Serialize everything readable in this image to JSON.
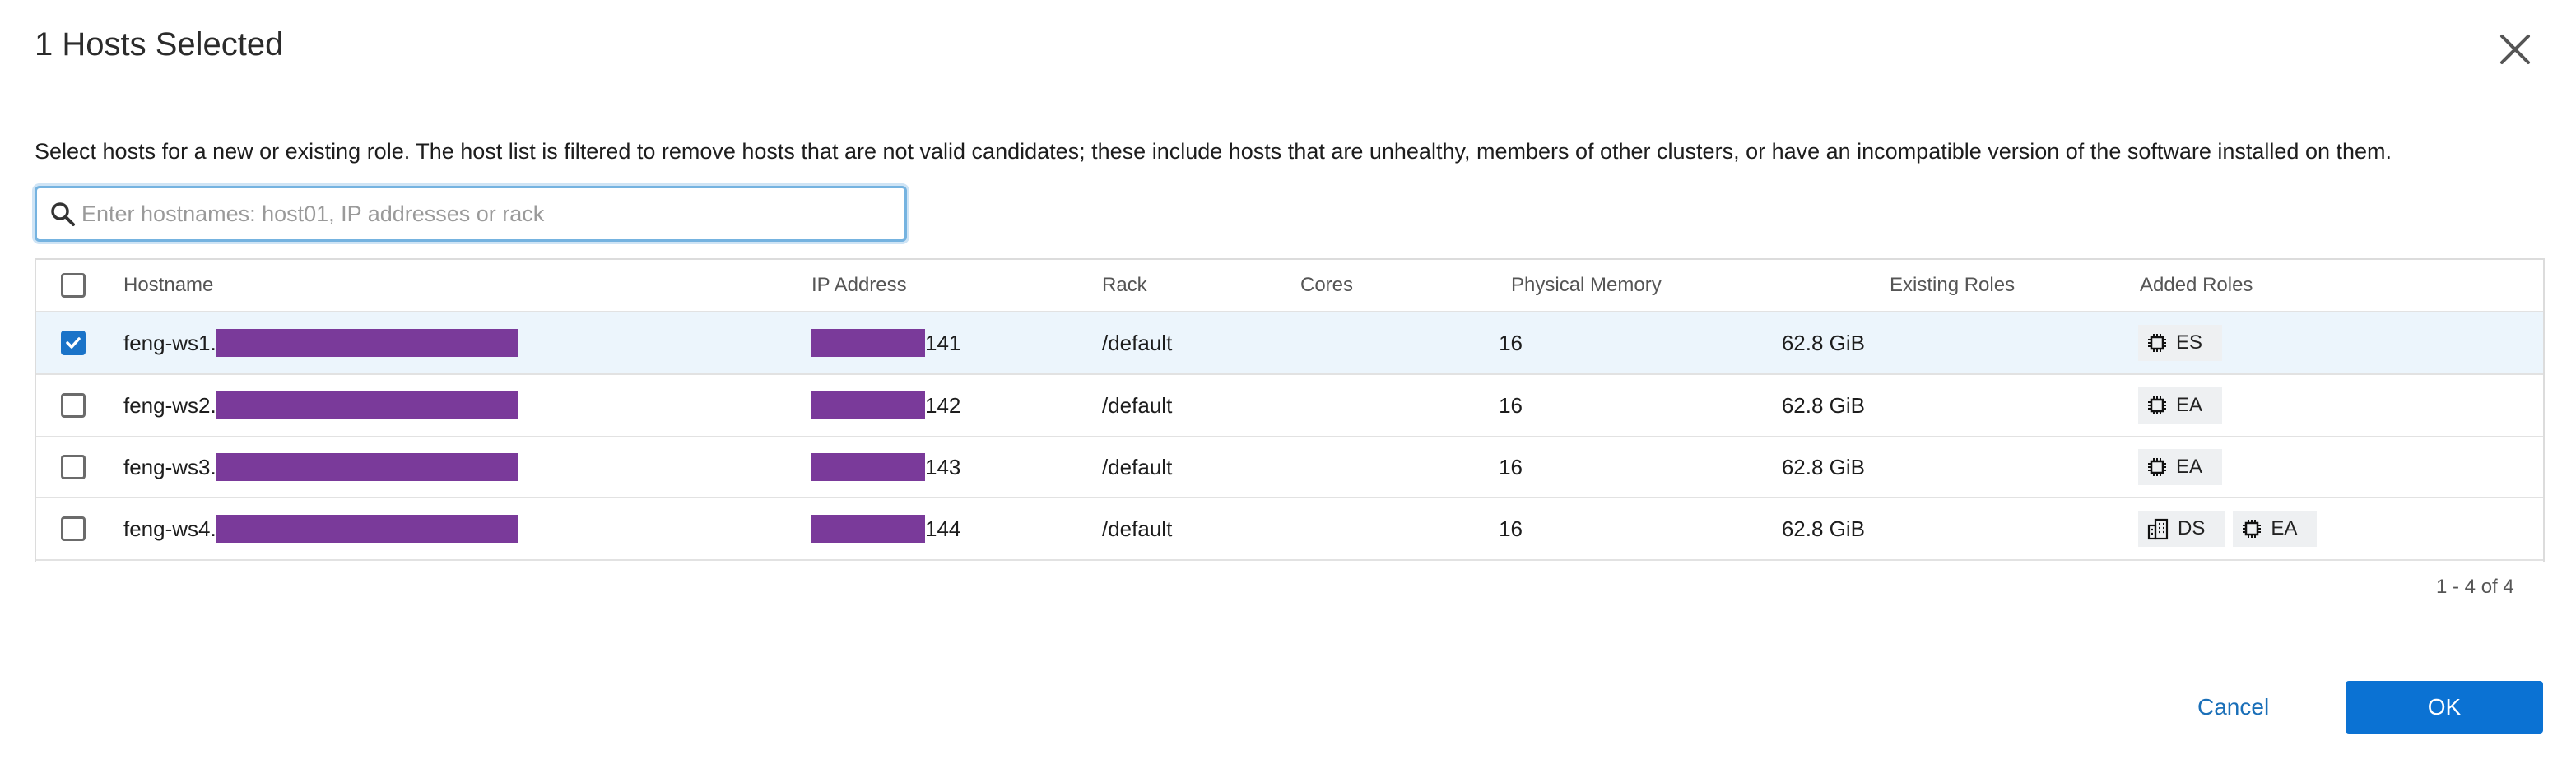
{
  "dialog": {
    "title": "1 Hosts Selected",
    "description": "Select hosts for a new or existing role. The host list is filtered to remove hosts that are not valid candidates; these include hosts that are unhealthy, members of other clusters, or have an incompatible version of the software installed on them."
  },
  "search": {
    "placeholder": "Enter hostnames: host01, IP addresses or rack",
    "value": ""
  },
  "table": {
    "columns": {
      "hostname": "Hostname",
      "ip": "IP Address",
      "rack": "Rack",
      "cores": "Cores",
      "memory": "Physical Memory",
      "existing_roles": "Existing Roles",
      "added_roles": "Added Roles"
    },
    "rows": [
      {
        "checked": true,
        "hostname_prefix": "feng-ws1.",
        "ip_suffix": "141",
        "rack": "/default",
        "cores": "16",
        "memory": "62.8 GiB",
        "existing_roles": "",
        "added_roles": [
          {
            "icon": "chip-icon",
            "label": "ES"
          }
        ]
      },
      {
        "checked": false,
        "hostname_prefix": "feng-ws2.",
        "ip_suffix": "142",
        "rack": "/default",
        "cores": "16",
        "memory": "62.8 GiB",
        "existing_roles": "",
        "added_roles": [
          {
            "icon": "chip-icon",
            "label": "EA"
          }
        ]
      },
      {
        "checked": false,
        "hostname_prefix": "feng-ws3.",
        "ip_suffix": "143",
        "rack": "/default",
        "cores": "16",
        "memory": "62.8 GiB",
        "existing_roles": "",
        "added_roles": [
          {
            "icon": "chip-icon",
            "label": "EA"
          }
        ]
      },
      {
        "checked": false,
        "hostname_prefix": "feng-ws4.",
        "ip_suffix": "144",
        "rack": "/default",
        "cores": "16",
        "memory": "62.8 GiB",
        "existing_roles": "",
        "added_roles": [
          {
            "icon": "building-icon",
            "label": "DS"
          },
          {
            "icon": "chip-icon",
            "label": "EA"
          }
        ]
      }
    ]
  },
  "pagination": "1 - 4 of 4",
  "buttons": {
    "cancel": "Cancel",
    "ok": "OK"
  },
  "colors": {
    "accent": "#0b72d3",
    "selected_row": "#ecf5fc",
    "redaction": "#7a3a9a"
  },
  "icons": [
    "close-icon",
    "search-icon",
    "check-icon",
    "chip-icon",
    "building-icon"
  ]
}
